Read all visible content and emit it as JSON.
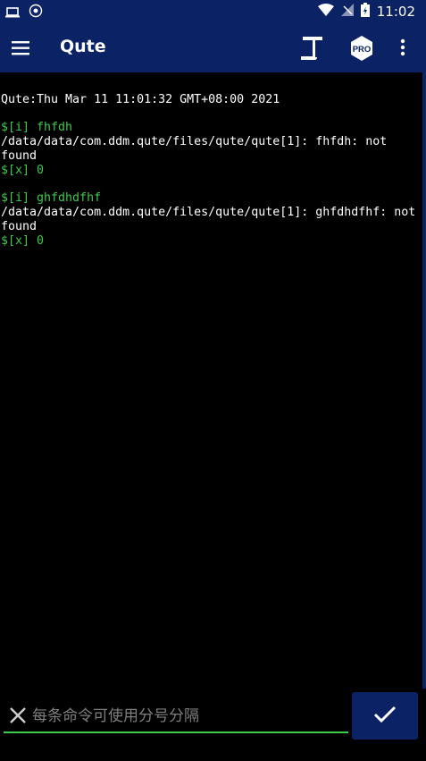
{
  "status_bar": {
    "time": "11:02"
  },
  "app_bar": {
    "title": "Qute",
    "pro_label": "PRO"
  },
  "terminal": {
    "lines": [
      {
        "text": "Qute:Thu Mar 11 11:01:32 GMT+08:00 2021",
        "kind": "output"
      },
      {
        "text": "",
        "kind": "gap"
      },
      {
        "text": "$[i] fhfdh",
        "kind": "command"
      },
      {
        "text": "/data/data/com.ddm.qute/files/qute/qute[1]: fhfdh: not found",
        "kind": "output"
      },
      {
        "text": "$[x] 0",
        "kind": "command"
      },
      {
        "text": "",
        "kind": "gap"
      },
      {
        "text": "$[i] ghfdhdfhf",
        "kind": "command"
      },
      {
        "text": "/data/data/com.ddm.qute/files/qute/qute[1]: ghfdhdfhf: not found",
        "kind": "output"
      },
      {
        "text": "$[x] 0",
        "kind": "command"
      }
    ]
  },
  "input": {
    "placeholder": "每条命令可使用分号分隔",
    "value": ""
  },
  "colors": {
    "bar": "#0b2265",
    "command": "#3ccb4a",
    "background": "#000000"
  }
}
